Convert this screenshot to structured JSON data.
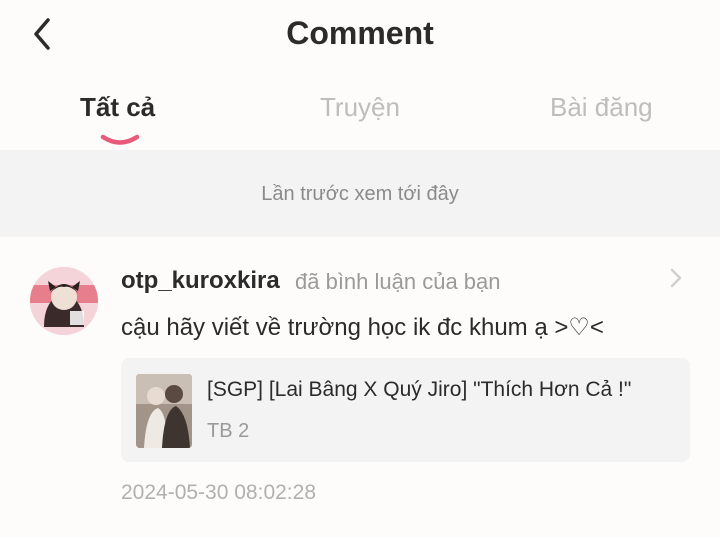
{
  "header": {
    "title": "Comment"
  },
  "tabs": [
    {
      "label": "Tất cả",
      "active": true
    },
    {
      "label": "Truyện",
      "active": false
    },
    {
      "label": "Bài đăng",
      "active": false
    }
  ],
  "notice": {
    "text": "Lần trước xem tới đây"
  },
  "comment": {
    "username": "otp_kuroxkira",
    "action": "đã bình luận của bạn",
    "text": "cậu hãy viết về trường học ik đc khum ạ >♡<",
    "story": {
      "title": "[SGP] [Lai Bâng X Quý Jiro] \"Thích Hơn Cả !\"",
      "subtitle": "TB 2"
    },
    "timestamp": "2024-05-30 08:02:28"
  },
  "colors": {
    "accent": "#e85a7a",
    "text": "#2b2b2b",
    "muted": "#9a9a9a"
  },
  "icons": {
    "back": "back-arrow-icon",
    "chevron": "chevron-right-icon"
  }
}
